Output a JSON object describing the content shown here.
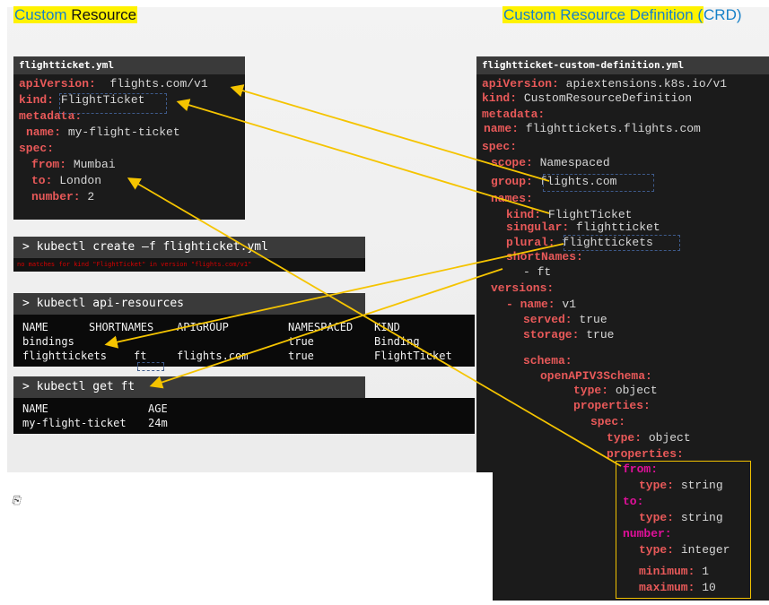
{
  "titles": {
    "left_part1": "Custom",
    "left_part2": " Resource",
    "right_part1": "Custom Resource Definition (",
    "right_part2": "CRD",
    "right_part3": ")"
  },
  "flightticket": {
    "filename": "flightticket.yml",
    "lines": {
      "apiVersion_k": "apiVersion:",
      "apiVersion_v": "flights.com/v1",
      "kind_k": "kind:",
      "kind_v": "FlightTicket",
      "metadata_k": "metadata:",
      "name_k": "name:",
      "name_v": "my-flight-ticket",
      "spec_k": "spec:",
      "from_k": "from:",
      "from_v": "Mumbai",
      "to_k": "to:",
      "to_v": "London",
      "number_k": "number:",
      "number_v": "2"
    }
  },
  "create_cmd": {
    "command": "> kubectl create –f flighticket.yml",
    "error": "no matches for kind \"FlightTicket\" in version \"flights.com/v1\""
  },
  "api_resources": {
    "command": "> kubectl api-resources",
    "headers": [
      "NAME",
      "SHORTNAMES",
      "APIGROUP",
      "NAMESPACED",
      "KIND"
    ],
    "rows": [
      [
        "bindings",
        "",
        "",
        "true",
        "Binding"
      ],
      [
        "flighttickets",
        "ft",
        "flights.com",
        "true",
        "FlightTicket"
      ]
    ]
  },
  "get_ft": {
    "command": "> kubectl get ft",
    "headers": [
      "NAME",
      "AGE"
    ],
    "rows": [
      [
        "my-flight-ticket",
        "24m"
      ]
    ]
  },
  "crd": {
    "filename": "flightticket-custom-definition.yml",
    "lines": {
      "apiVersion_k": "apiVersion:",
      "apiVersion_v": "apiextensions.k8s.io/v1",
      "kind_k": "kind:",
      "kind_v": "CustomResourceDefinition",
      "metadata_k": "metadata:",
      "name_k": "name:",
      "name_v": "flighttickets.flights.com",
      "spec_k": "spec:",
      "scope_k": "scope:",
      "scope_v": "Namespaced",
      "group_k": "group:",
      "group_v": "flights.com",
      "names_k": "names:",
      "kind2_k": "kind:",
      "kind2_v": "FlightTicket",
      "singular_k": "singular:",
      "singular_v": "flightticket",
      "plural_k": "plural:",
      "plural_v": "flighttickets",
      "shortNames_k": "shortNames:",
      "shortNames_v": "- ft",
      "versions_k": "versions:",
      "vname_k": "- name:",
      "vname_v": "v1",
      "served_k": "served:",
      "served_v": "true",
      "storage_k": "storage:",
      "storage_v": "true",
      "schema_k": "schema:",
      "openapi_k": "openAPIV3Schema:",
      "type1_k": "type:",
      "type1_v": "object",
      "props1_k": "properties:",
      "spec2_k": "spec:",
      "type2_k": "type:",
      "type2_v": "object",
      "props2_k": "properties:",
      "from_k": "from:",
      "type_from_k": "type:",
      "type_from_v": "string",
      "to_k": "to:",
      "type_to_k": "type:",
      "type_to_v": "string",
      "number_k": "number:",
      "type_num_k": "type:",
      "type_num_v": "integer",
      "min_k": "minimum:",
      "min_v": "1",
      "max_k": "maximum:",
      "max_v": "10"
    }
  },
  "colors": {
    "arrow": "#f5c400",
    "highlight": "#fff200",
    "yaml_key": "#e85959",
    "yaml_prop": "#e0109a"
  },
  "icons": {
    "link": "link-icon"
  }
}
